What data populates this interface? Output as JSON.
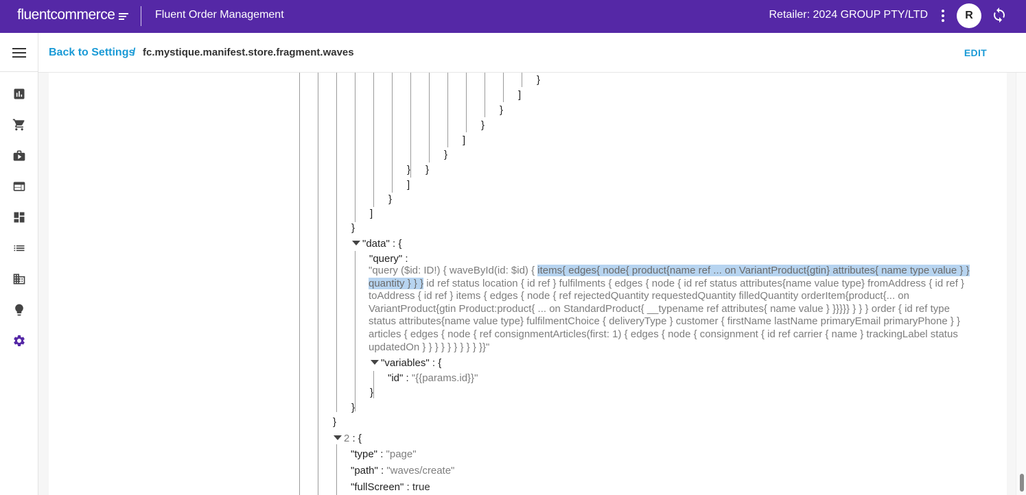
{
  "header": {
    "logo_text": "fluentcommerce",
    "app_title": "Fluent Order Management",
    "retailer": "Retailer: 2024 GROUP PTY/LTD",
    "avatar_initial": "R"
  },
  "sidebar": {
    "items": [
      {
        "icon": "bar-chart-icon"
      },
      {
        "icon": "cart-icon"
      },
      {
        "icon": "briefcase-play-icon"
      },
      {
        "icon": "browser-window-icon"
      },
      {
        "icon": "dashboard-icon"
      },
      {
        "icon": "list-icon"
      },
      {
        "icon": "building-icon"
      },
      {
        "icon": "lightbulb-icon"
      },
      {
        "icon": "gear-icon",
        "active": true
      }
    ],
    "active_color": "#5528a6"
  },
  "breadcrumb": {
    "back_label": "Back to Settings",
    "separator": "/",
    "current": "fc.mystique.manifest.store.fragment.waves",
    "edit_label": "EDIT"
  },
  "json_view": {
    "closers": [
      "}",
      "]",
      "}",
      "}",
      "]",
      "}",
      "]",
      "}",
      "]",
      "}",
      "]",
      "}"
    ],
    "data_key": "\"data\"",
    "colon_brace": ": {",
    "query_key": "\"query\"",
    "colon": ":",
    "query_highlight": "items{ edges{ node{ product{name ref ... on VariantProduct{gtin} attributes{ name type value } } quantity } } }",
    "query_before": "\"query ($id: ID!) { waveById(id: $id) { ",
    "query_after": " id ref status location { id ref } fulfilments { edges { node { id ref status attributes{name value type} fromAddress { id ref } toAddress { id ref } items { edges { node { ref rejectedQuantity requestedQuantity filledQuantity orderItem{product{... on VariantProduct{gtin Product:product{ ... on StandardProduct{ __typename ref attributes{ name value } }}}}} } } } order { id ref type status attributes{name value type} fulfilmentChoice { deliveryType } customer { firstName lastName primaryEmail primaryPhone } } articles { edges { node { ref consignmentArticles(first: 1) { edges { node { consignment { id ref carrier { name } trackingLabel status updatedOn } } } } } } } } } }}\"",
    "variables_key": "\"variables\"",
    "id_key": "\"id\"",
    "id_value": "\"{{params.id}}\"",
    "close_brace": "}",
    "item_index": "2",
    "type_key": "\"type\"",
    "type_value": "\"page\"",
    "path_key": "\"path\"",
    "path_value": "\"waves/create\"",
    "fullscreen_key": "\"fullScreen\"",
    "fullscreen_value": "true"
  }
}
